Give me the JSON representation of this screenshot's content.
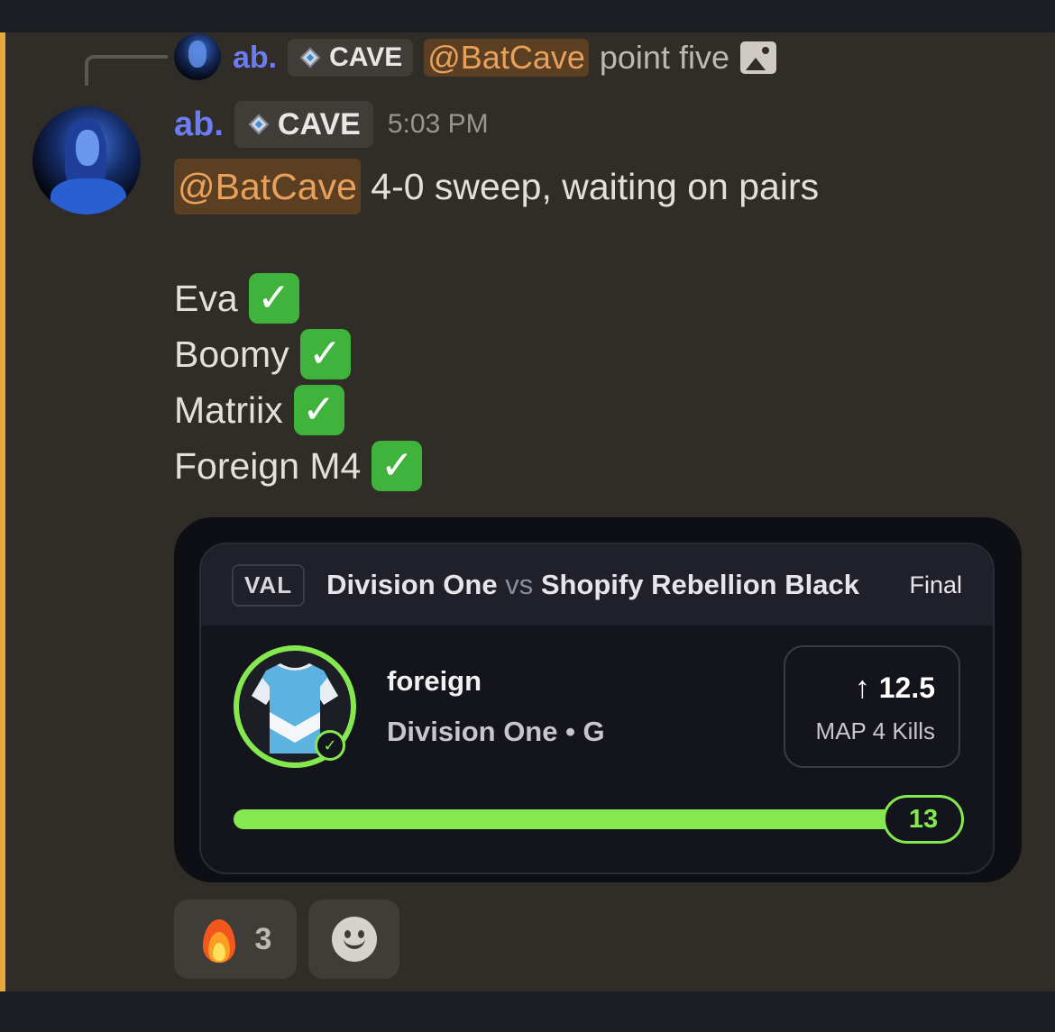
{
  "reply": {
    "author": "ab.",
    "tag": "CAVE",
    "mention": "@BatCave",
    "text": "point five"
  },
  "message": {
    "author": "ab.",
    "tag": "CAVE",
    "timestamp": "5:03 PM",
    "mention": "@BatCave",
    "text": "4-0 sweep, waiting on pairs",
    "picks": [
      {
        "name": "Eva",
        "status": "✓"
      },
      {
        "name": "Boomy",
        "status": "✓"
      },
      {
        "name": "Matriix",
        "status": "✓"
      },
      {
        "name": "Foreign M4",
        "status": "✓"
      }
    ]
  },
  "embed": {
    "league": "VAL",
    "team_a": "Division One",
    "vs": "vs",
    "team_b": "Shopify Rebellion Black",
    "status": "Final",
    "player": "foreign",
    "player_team": "Division One • G",
    "line": "12.5",
    "direction_icon": "arrow-up-icon",
    "stat": "MAP 4 Kills",
    "result": "13",
    "progress_fraction": 0.94,
    "accent_color": "#86e84f"
  },
  "reactions": [
    {
      "emoji": "fire-icon",
      "count": "3"
    }
  ],
  "colors": {
    "username": "#6c7cf2",
    "mention_bg": "#5b3f22",
    "mention_text": "#e8a05a",
    "highlight_bar": "#e8a93a",
    "check": "#3fb33b"
  }
}
